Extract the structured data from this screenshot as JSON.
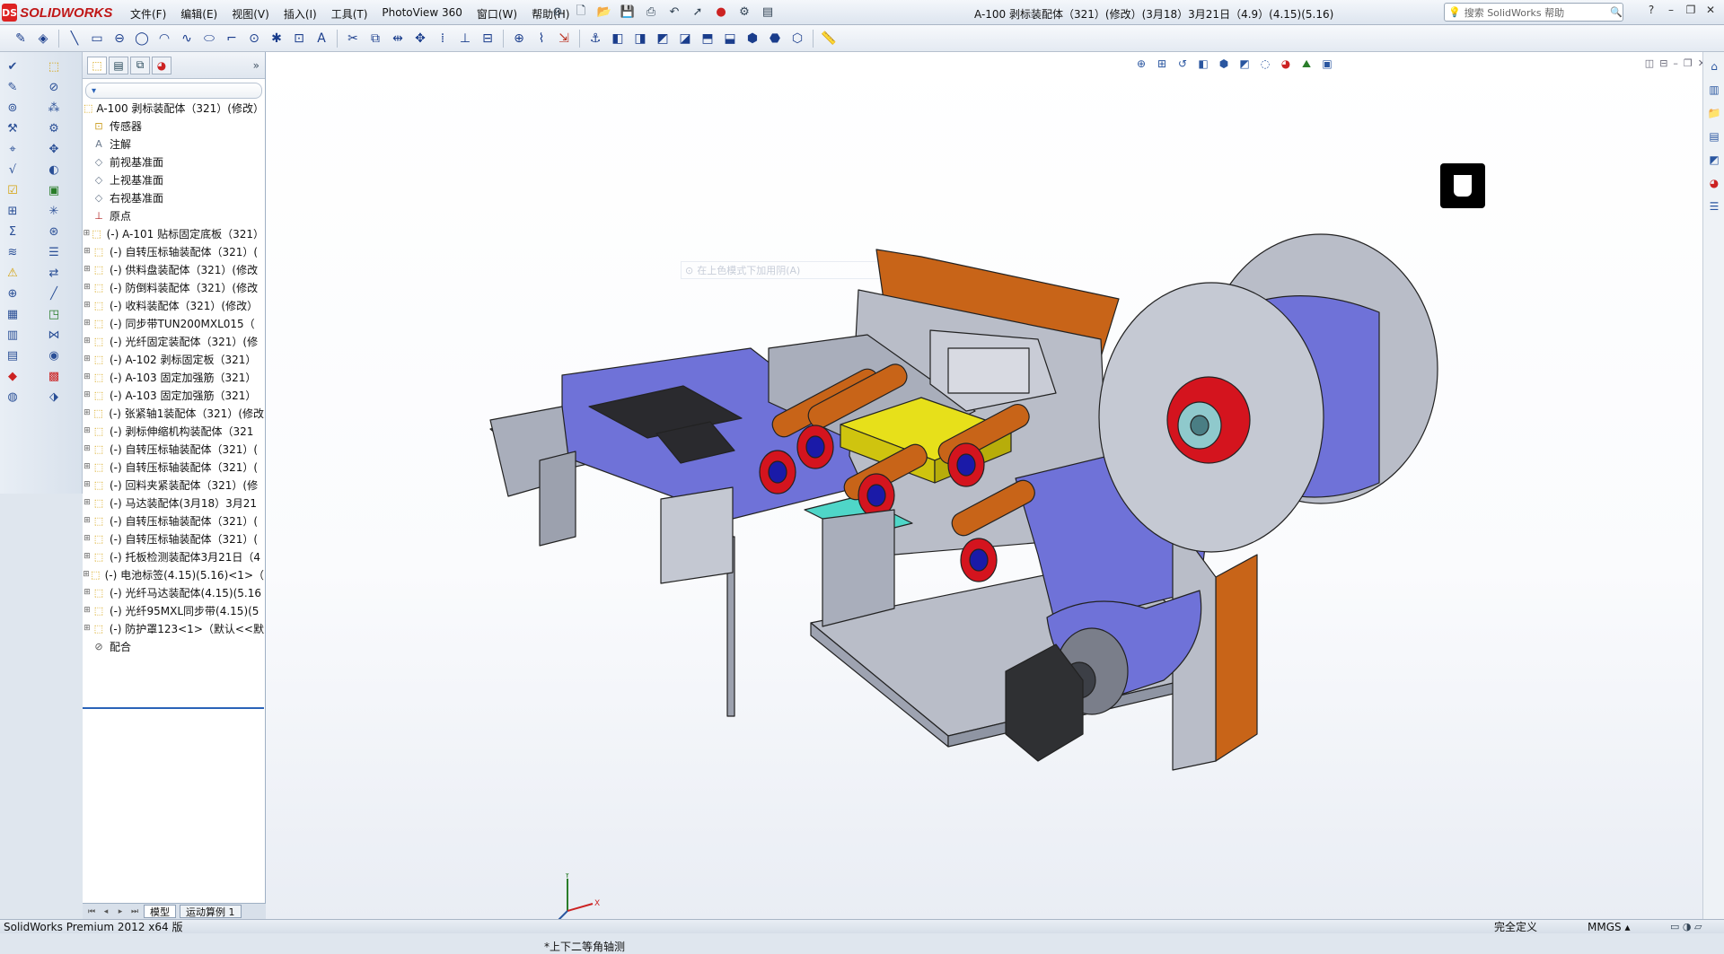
{
  "titlebar": {
    "app_name": "SOLIDWORKS",
    "logo_mark": "DS",
    "menus": [
      "文件(F)",
      "编辑(E)",
      "视图(V)",
      "插入(I)",
      "工具(T)",
      "PhotoView 360",
      "窗口(W)",
      "帮助(H)"
    ],
    "document_title": "A-100 剥标装配体（321）(修改）(3月18）3月21日（4.9）(4.15)(5.16)",
    "help_search_placeholder": "搜索 SolidWorks 帮助",
    "quick_access_icons": [
      "pin-icon",
      "new-doc-icon",
      "open-icon",
      "save-icon",
      "print-icon",
      "undo-icon",
      "select-icon",
      "traffic-light-icon",
      "options-icon",
      "customize-icon"
    ],
    "window_buttons": [
      "help-icon",
      "minimize-icon",
      "restore-icon",
      "close-icon"
    ]
  },
  "command_bar": {
    "icons": [
      "sketch-icon",
      "smart-dimension-icon",
      "line-icon",
      "rectangle-icon",
      "slot-icon",
      "circle-icon",
      "arc-icon",
      "spline-icon",
      "ellipse-icon",
      "fillet-icon",
      "point-icon",
      "centerline-icon",
      "text-icon",
      "trim-icon",
      "convert-icon",
      "offset-icon",
      "mirror-icon",
      "move-icon",
      "pattern-icon",
      "relations-icon",
      "repair-icon",
      "quick-snap-icon",
      "rapid-sketch-icon",
      "instant2d-icon",
      "view-orient-icon",
      "front-view-icon",
      "back-view-icon",
      "left-view-icon",
      "right-view-icon",
      "top-view-icon",
      "bottom-view-icon",
      "iso-view-icon",
      "dimetric-view-icon",
      "trimetric-view-icon",
      "measure-icon"
    ]
  },
  "feature_manager": {
    "tabs": [
      "feature-tree-tab",
      "property-tab",
      "config-tab",
      "appearance-tab"
    ],
    "filter_label": "▾",
    "root": "A-100 剥标装配体（321）(修改）",
    "items": [
      {
        "label": "传感器",
        "type": "folder"
      },
      {
        "label": "注解",
        "type": "annotation"
      },
      {
        "label": "前视基准面",
        "type": "plane"
      },
      {
        "label": "上视基准面",
        "type": "plane"
      },
      {
        "label": "右视基准面",
        "type": "plane"
      },
      {
        "label": "原点",
        "type": "origin"
      },
      {
        "label": "(-) A-101 贴标固定底板（321）",
        "type": "asm"
      },
      {
        "label": "(-) 自转压标轴装配体（321）(",
        "type": "asm"
      },
      {
        "label": "(-) 供料盘装配体（321）(修改",
        "type": "asm"
      },
      {
        "label": "(-) 防倒料装配体（321）(修改",
        "type": "asm"
      },
      {
        "label": "(-) 收料装配体（321）(修改）",
        "type": "asm"
      },
      {
        "label": "(-) 同步带TUN200MXL015（",
        "type": "asm"
      },
      {
        "label": "(-) 光纤固定装配体（321）(修",
        "type": "asm"
      },
      {
        "label": "(-) A-102 剥标固定板（321）",
        "type": "asm"
      },
      {
        "label": "(-) A-103 固定加强筋（321）",
        "type": "asm"
      },
      {
        "label": "(-) A-103 固定加强筋（321）",
        "type": "asm"
      },
      {
        "label": "(-) 张紧轴1装配体（321）(修改",
        "type": "asm"
      },
      {
        "label": "(-) 剥标伸缩机构装配体（321",
        "type": "asm"
      },
      {
        "label": "(-) 自转压标轴装配体（321）(",
        "type": "asm"
      },
      {
        "label": "(-) 自转压标轴装配体（321）(",
        "type": "asm"
      },
      {
        "label": "(-) 回料夹紧装配体（321）(修",
        "type": "asm"
      },
      {
        "label": "(-) 马达装配体(3月18）3月21",
        "type": "asm"
      },
      {
        "label": "(-) 自转压标轴装配体（321）(",
        "type": "asm"
      },
      {
        "label": "(-) 自转压标轴装配体（321）(",
        "type": "asm"
      },
      {
        "label": "(-) 托板检测装配体3月21日（4",
        "type": "asm"
      },
      {
        "label": "(-) 电池标签(4.15)(5.16)<1>（",
        "type": "asm"
      },
      {
        "label": "(-) 光纤马达装配体(4.15)(5.16",
        "type": "asm"
      },
      {
        "label": "(-) 光纤95MXL同步带(4.15)(5",
        "type": "asm"
      },
      {
        "label": "(-) 防护罩123<1>（默认<<默",
        "type": "asm"
      },
      {
        "label": "配合",
        "type": "mate"
      }
    ],
    "bottom_tabs": [
      "模型",
      "运动算例 1"
    ]
  },
  "viewport": {
    "view_label": "*上下二等角轴测",
    "ghost_hint": "在上色模式下加用阴(A)",
    "triad_axes": [
      "X",
      "Y",
      "Z"
    ],
    "headsup_icons": [
      "zoom-fit-icon",
      "zoom-area-icon",
      "previous-view-icon",
      "section-view-icon",
      "view-orientation-icon",
      "display-style-icon",
      "hide-show-icon",
      "edit-appearance-icon",
      "apply-scene-icon",
      "view-settings-icon"
    ],
    "taskpane_icons": [
      "home-icon",
      "resources-icon",
      "design-library-icon",
      "file-explorer-icon",
      "view-palette-icon",
      "appearances-icon",
      "custom-props-icon"
    ]
  },
  "statusbar": {
    "product": "SolidWorks Premium 2012 x64 版",
    "definition": "完全定义",
    "units": "MMGS ▴"
  },
  "colors": {
    "accent_blue": "#2a63b8",
    "model_gray": "#b9bdc8",
    "model_purple": "#6f72d8",
    "model_orange": "#c86418",
    "model_red": "#d4141e",
    "model_yellow": "#e7e01a",
    "model_teal": "#4fd6c8"
  }
}
